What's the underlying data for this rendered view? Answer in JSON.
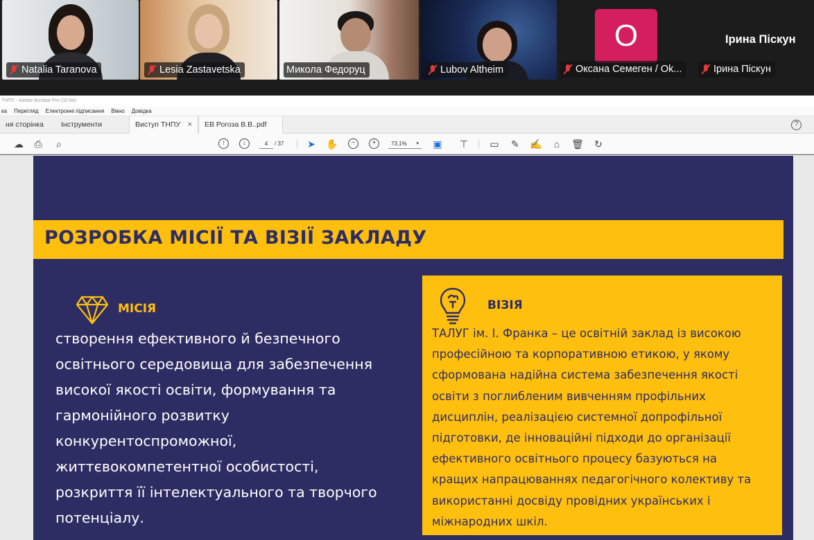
{
  "participants": [
    {
      "name": "Natalia Taranova"
    },
    {
      "name": "Lesia Zastavetska"
    },
    {
      "name": "Микола Федоруц"
    },
    {
      "name": "Lubov Altheim"
    },
    {
      "name": "Оксана Семеген / Ok..."
    },
    {
      "name": "Ірина Піскун"
    }
  ],
  "avatar": {
    "initial": "О",
    "color": "#d51e5e"
  },
  "featured_name": "Ірина Піскун",
  "acrobat": {
    "window_title": "ТНПУ - Adobe Acrobat Pro (32-bit)",
    "menu": [
      "ка",
      "Перегляд",
      "Електронні підписання",
      "Вікно",
      "Довідка"
    ],
    "tabs": [
      {
        "label": "ня сторінка"
      },
      {
        "label": "Інструменти"
      },
      {
        "label": "Виступ ТНПУ"
      },
      {
        "label": "ЕВ Рогоза В.В..pdf"
      }
    ],
    "tab_close": "×",
    "help": "?",
    "page_current": "4",
    "page_total": "/ 37",
    "zoom": "73,1%"
  },
  "slide": {
    "title": "РОЗРОБКА МІСІЇ ТА ВІЗІЇ  ЗАКЛАДУ",
    "mission_heading": "МІСІЯ",
    "mission_lines": [
      "створення ефективного й безпечного",
      "освітнього середовища для забезпечення",
      "високої якості освіти, формування та",
      "гармонійного розвитку",
      "конкурентоспроможної,",
      "життєвокомпетентної особистості,",
      "розкриття її інтелектуального та творчого",
      "потенціалу."
    ],
    "vision_heading": "ВІЗІЯ",
    "vision_lines": [
      "ТАЛУГ ім. І. Франка – це освітній заклад із високою",
      "професійною та корпоративною етикою, у якому",
      "сформована надійна система забезпечення якості",
      "освіти з поглибленим вивченням профільних",
      "дисциплін, реалізацією системної допрофільної",
      "підготовки, де інноваційні підходи до організації",
      "ефективного освітнього процесу базуються на",
      "кращих напрацюваннях педагогічного колективу та",
      "використанні досвіду провідних українських і",
      "міжнародних шкіл."
    ],
    "colors": {
      "navy": "#2e2d63",
      "yellow": "#ffbf0f"
    }
  }
}
